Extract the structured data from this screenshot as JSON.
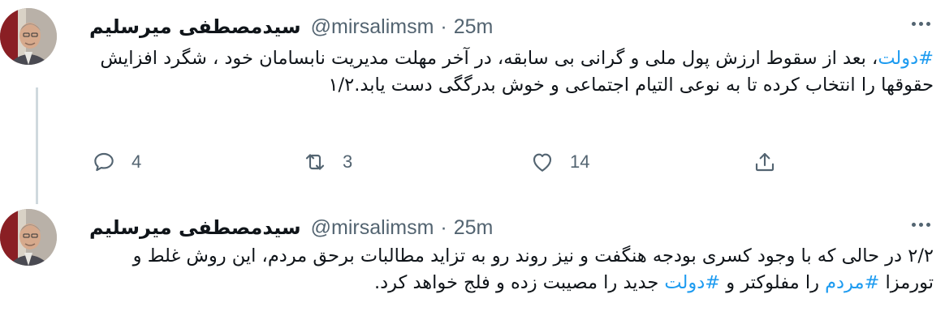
{
  "tweets": [
    {
      "author": {
        "name": "سیدمصطفی میرسلیم",
        "handle": "@mirsalimsm",
        "separator": "·",
        "time": "25m"
      },
      "segments": [
        {
          "text": "#دولت",
          "hashtag": true
        },
        {
          "text": "، بعد از سقوط ارزش پول ملی و گرانی بی سابقه، در آخر مهلت مدیریت نابسامان خود ، شگرد افزایش حقوقها را انتخاب کرده تا به نوعی التیام اجتماعی و خوش بدرگگی دست یابد.۱/۲",
          "hashtag": false
        }
      ],
      "actions": {
        "reply_count": "4",
        "retweet_count": "3",
        "like_count": "14"
      }
    },
    {
      "author": {
        "name": "سیدمصطفی میرسلیم",
        "handle": "@mirsalimsm",
        "separator": "·",
        "time": "25m"
      },
      "segments": [
        {
          "text": "۲/۲ در حالی که با وجود کسری بودجه هنگفت و نیز روند رو به تزاید مطالبات برحق مردم، این روش غلط و تورمزا ",
          "hashtag": false
        },
        {
          "text": "#مردم",
          "hashtag": true
        },
        {
          "text": " را مفلوکتر و ",
          "hashtag": false
        },
        {
          "text": "#دولت",
          "hashtag": true
        },
        {
          "text": " جدید را مصیبت زده و فلج خواهد کرد.",
          "hashtag": false
        }
      ]
    }
  ],
  "colors": {
    "text": "#0f1419",
    "secondary": "#536471",
    "hashtag": "#1d9bf0",
    "thread_line": "#cfd9de"
  },
  "icons": [
    "reply-icon",
    "retweet-icon",
    "like-icon",
    "share-icon",
    "more-options-icon"
  ]
}
